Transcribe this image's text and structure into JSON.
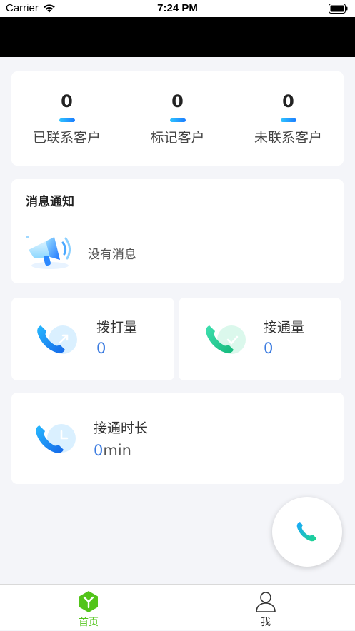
{
  "status_bar": {
    "carrier": "Carrier",
    "time": "7:24 PM"
  },
  "stats": [
    {
      "value": "0",
      "label": "已联系客户"
    },
    {
      "value": "0",
      "label": "标记客户"
    },
    {
      "value": "0",
      "label": "未联系客户"
    }
  ],
  "notice": {
    "title": "消息通知",
    "empty_text": "没有消息"
  },
  "metrics": {
    "dial": {
      "label": "拨打量",
      "value": "0"
    },
    "connected": {
      "label": "接通量",
      "value": "0"
    },
    "duration": {
      "label": "接通时长",
      "value": "0",
      "unit": "min"
    }
  },
  "tabbar": {
    "home": {
      "label": "首页"
    },
    "me": {
      "label": "我"
    }
  },
  "colors": {
    "accent_blue": "#3b7be0",
    "active_tab": "#52c41a",
    "call_green": "#1ec98a"
  }
}
